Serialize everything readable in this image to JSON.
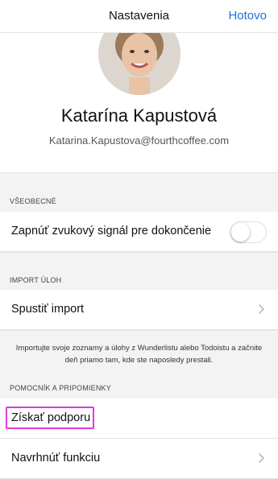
{
  "navbar": {
    "title": "Nastavenia",
    "done_label": "Hotovo"
  },
  "profile": {
    "name": "Katarína Kapustová",
    "email": "Katarina.Kapustova@fourthcoffee.com"
  },
  "sections": {
    "general": {
      "header": "VŠEOBECNÉ",
      "sound_toggle_label": "Zapnúť zvukový signál pre dokončenie",
      "sound_toggle_on": false
    },
    "import": {
      "header": "IMPORT ÚLOH",
      "start_import_label": "Spustiť import",
      "note": "Importujte svoje zoznamy a úlohy z Wunderlistu alebo Todoistu a začnite deň priamo tam, kde ste naposledy prestali."
    },
    "help": {
      "header": "POMOCNÍK A PRIPOMIENKY",
      "support_label": "Získať podporu",
      "suggest_label": "Navrhnúť funkciu"
    }
  },
  "colors": {
    "accent": "#1f6fe0",
    "highlight": "#e03ad8"
  }
}
